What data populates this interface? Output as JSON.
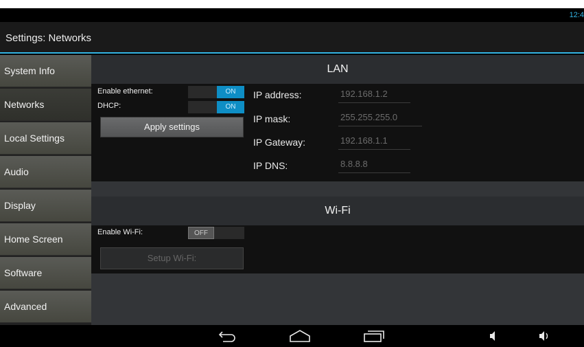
{
  "status_bar": {
    "clock": "12:4"
  },
  "action_bar": {
    "title": "Settings: Networks"
  },
  "sidebar": {
    "items": [
      {
        "label": "System Info"
      },
      {
        "label": "Networks"
      },
      {
        "label": "Local Settings"
      },
      {
        "label": "Audio"
      },
      {
        "label": "Display"
      },
      {
        "label": "Home Screen"
      },
      {
        "label": "Software"
      },
      {
        "label": "Advanced"
      }
    ],
    "selected": "Networks"
  },
  "lan": {
    "heading": "LAN",
    "enable_ethernet_label": "Enable ethernet:",
    "enable_ethernet_state": "ON",
    "dhcp_label": "DHCP:",
    "dhcp_state": "ON",
    "apply_button": "Apply settings",
    "ip_address_label": "IP address:",
    "ip_address_value": "192.168.1.2",
    "ip_mask_label": "IP mask:",
    "ip_mask_value": "255.255.255.0",
    "ip_gateway_label": "IP Gateway:",
    "ip_gateway_value": "192.168.1.1",
    "ip_dns_label": "IP DNS:",
    "ip_dns_value": "8.8.8.8"
  },
  "wifi": {
    "heading": "Wi-Fi",
    "enable_wifi_label": "Enable Wi-Fi:",
    "enable_wifi_state": "OFF",
    "setup_button": "Setup Wi-Fi:"
  },
  "nav_bar": {
    "icons": [
      "back-icon",
      "home-icon",
      "recent-apps-icon",
      "volume-down-icon",
      "volume-up-icon"
    ]
  },
  "colors": {
    "accent": "#33b5e5",
    "toggle_on": "#0e8ec5"
  }
}
